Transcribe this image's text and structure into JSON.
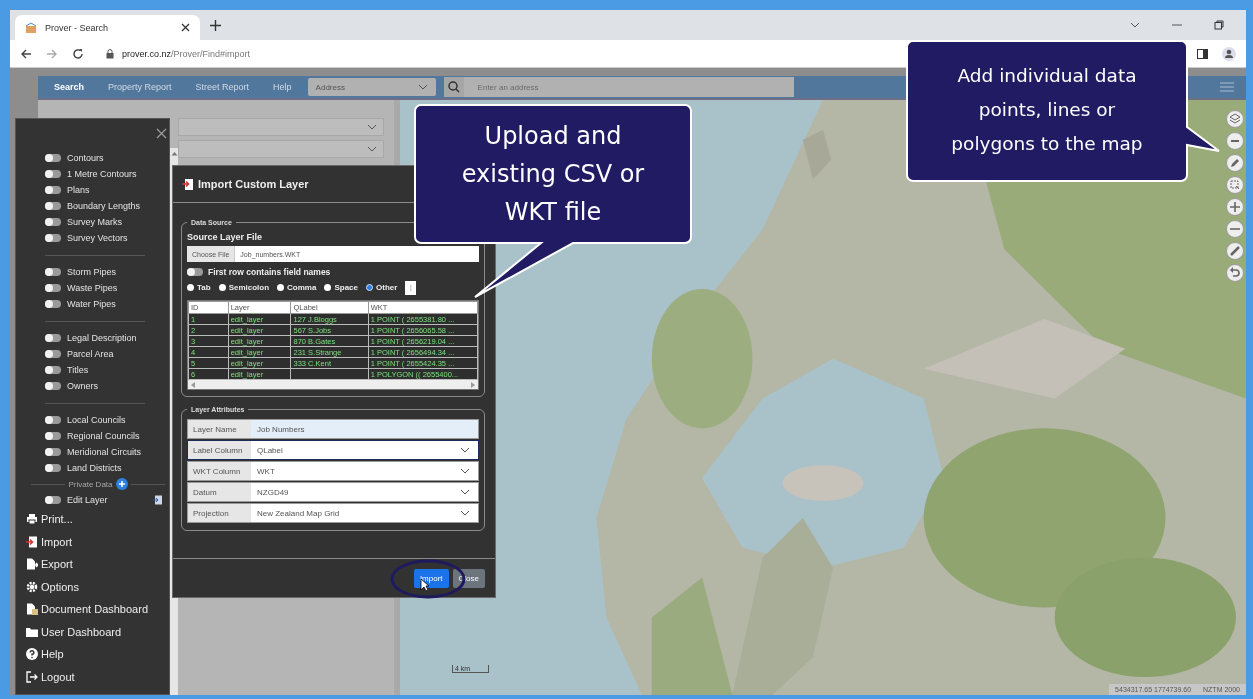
{
  "browser": {
    "tab_title": "Prover - Search",
    "url_domain": "prover.co.nz",
    "url_path": "/Prover/Find#import"
  },
  "navbar": {
    "items": [
      {
        "label": "Search",
        "selected": true
      },
      {
        "label": "Property Report",
        "selected": false
      },
      {
        "label": "Street Report",
        "selected": false
      },
      {
        "label": "Help",
        "selected": false
      }
    ],
    "search_type": "Address",
    "search": {
      "placeholder": "Enter an address"
    }
  },
  "layer_menu": {
    "groups": [
      [
        {
          "label": "Contours",
          "on": false
        },
        {
          "label": "1 Metre Contours",
          "on": false
        },
        {
          "label": "Plans",
          "on": false
        },
        {
          "label": "Boundary Lengths",
          "on": false
        },
        {
          "label": "Survey Marks",
          "on": false
        },
        {
          "label": "Survey Vectors",
          "on": false
        }
      ],
      [
        {
          "label": "Storm Pipes",
          "on": false
        },
        {
          "label": "Waste Pipes",
          "on": false
        },
        {
          "label": "Water Pipes",
          "on": false
        }
      ],
      [
        {
          "label": "Legal Description",
          "on": false
        },
        {
          "label": "Parcel Area",
          "on": false
        },
        {
          "label": "Titles",
          "on": false
        },
        {
          "label": "Owners",
          "on": false
        }
      ],
      [
        {
          "label": "Local Councils",
          "on": false
        },
        {
          "label": "Regional Councils",
          "on": false
        },
        {
          "label": "Meridional Circuits",
          "on": false
        },
        {
          "label": "Land Districts",
          "on": false
        }
      ]
    ],
    "private_data": {
      "label": "Private Data",
      "layers": [
        {
          "label": "Edit Layer",
          "on": false
        }
      ]
    },
    "actions": [
      {
        "label": "Print...",
        "kind": "print"
      },
      {
        "label": "Import",
        "kind": "import"
      },
      {
        "label": "Export",
        "kind": "export"
      },
      {
        "label": "Options",
        "kind": "options"
      },
      {
        "label": "Document Dashboard",
        "kind": "documents"
      },
      {
        "label": "User Dashboard",
        "kind": "folder"
      },
      {
        "label": "Help",
        "kind": "help"
      },
      {
        "label": "Logout",
        "kind": "logout"
      }
    ]
  },
  "dialog": {
    "title": "Import Custom Layer",
    "data_source": {
      "legend": "Data Source",
      "file_label": "Source Layer File",
      "choose_button": "Choose File",
      "file_name": "Job_numbers.WKT",
      "header_toggle": {
        "label": "First row contains field names",
        "on": false
      },
      "delimiters": [
        {
          "label": "Tab",
          "selected": false
        },
        {
          "label": "Semicolon",
          "selected": false
        },
        {
          "label": "Comma",
          "selected": false
        },
        {
          "label": "Space",
          "selected": false
        },
        {
          "label": "Other",
          "selected": true
        }
      ],
      "other_value": "|",
      "table": {
        "columns": [
          "ID",
          "Layer",
          "QLabel",
          "WKT"
        ],
        "rows": [
          {
            "id": "1",
            "layer": "edit_layer",
            "qlabel": "127 J.Bloggs",
            "wkt": "1 POINT ( 2655381.80 ..."
          },
          {
            "id": "2",
            "layer": "edit_layer",
            "qlabel": "567 S.Jobs",
            "wkt": "1 POINT ( 2656065.58 ..."
          },
          {
            "id": "3",
            "layer": "edit_layer",
            "qlabel": "870 B.Gates",
            "wkt": "1 POINT ( 2656219.04 ..."
          },
          {
            "id": "4",
            "layer": "edit_layer",
            "qlabel": "231 S.Strange",
            "wkt": "1 POINT ( 2656494.34 ..."
          },
          {
            "id": "5",
            "layer": "edit_layer",
            "qlabel": "333 C.Kent",
            "wkt": "1 POINT ( 2655424.35 ..."
          },
          {
            "id": "6",
            "layer": "edit_layer",
            "wkt": "1 POLYGON (( 2655400..."
          }
        ]
      }
    },
    "layer_attributes": {
      "legend": "Layer Attributes",
      "fields": [
        {
          "label": "Layer Name",
          "value": "Job Numbers",
          "kind": "text",
          "focused": false
        },
        {
          "label": "Label Column",
          "value": "QLabel",
          "kind": "select",
          "focused": true
        },
        {
          "label": "WKT Column",
          "value": "WKT",
          "kind": "select",
          "focused": false
        },
        {
          "label": "Datum",
          "value": "NZGD49",
          "kind": "select",
          "focused": false
        },
        {
          "label": "Projection",
          "value": "New Zealand Map Grid",
          "kind": "select",
          "focused": false
        }
      ]
    },
    "buttons": [
      {
        "label": "Import",
        "kind": "primary"
      },
      {
        "label": "Close",
        "kind": "secondary"
      }
    ]
  },
  "callouts": [
    {
      "text": "Upload and existing CSV or WKT file",
      "kind": "left"
    },
    {
      "text": "Add individual data points, lines or polygons to the map",
      "kind": "right"
    }
  ],
  "map": {
    "scale": "4 km",
    "coordinates": "5434317.65 1774739.60",
    "projection": "NZTM 2000"
  }
}
